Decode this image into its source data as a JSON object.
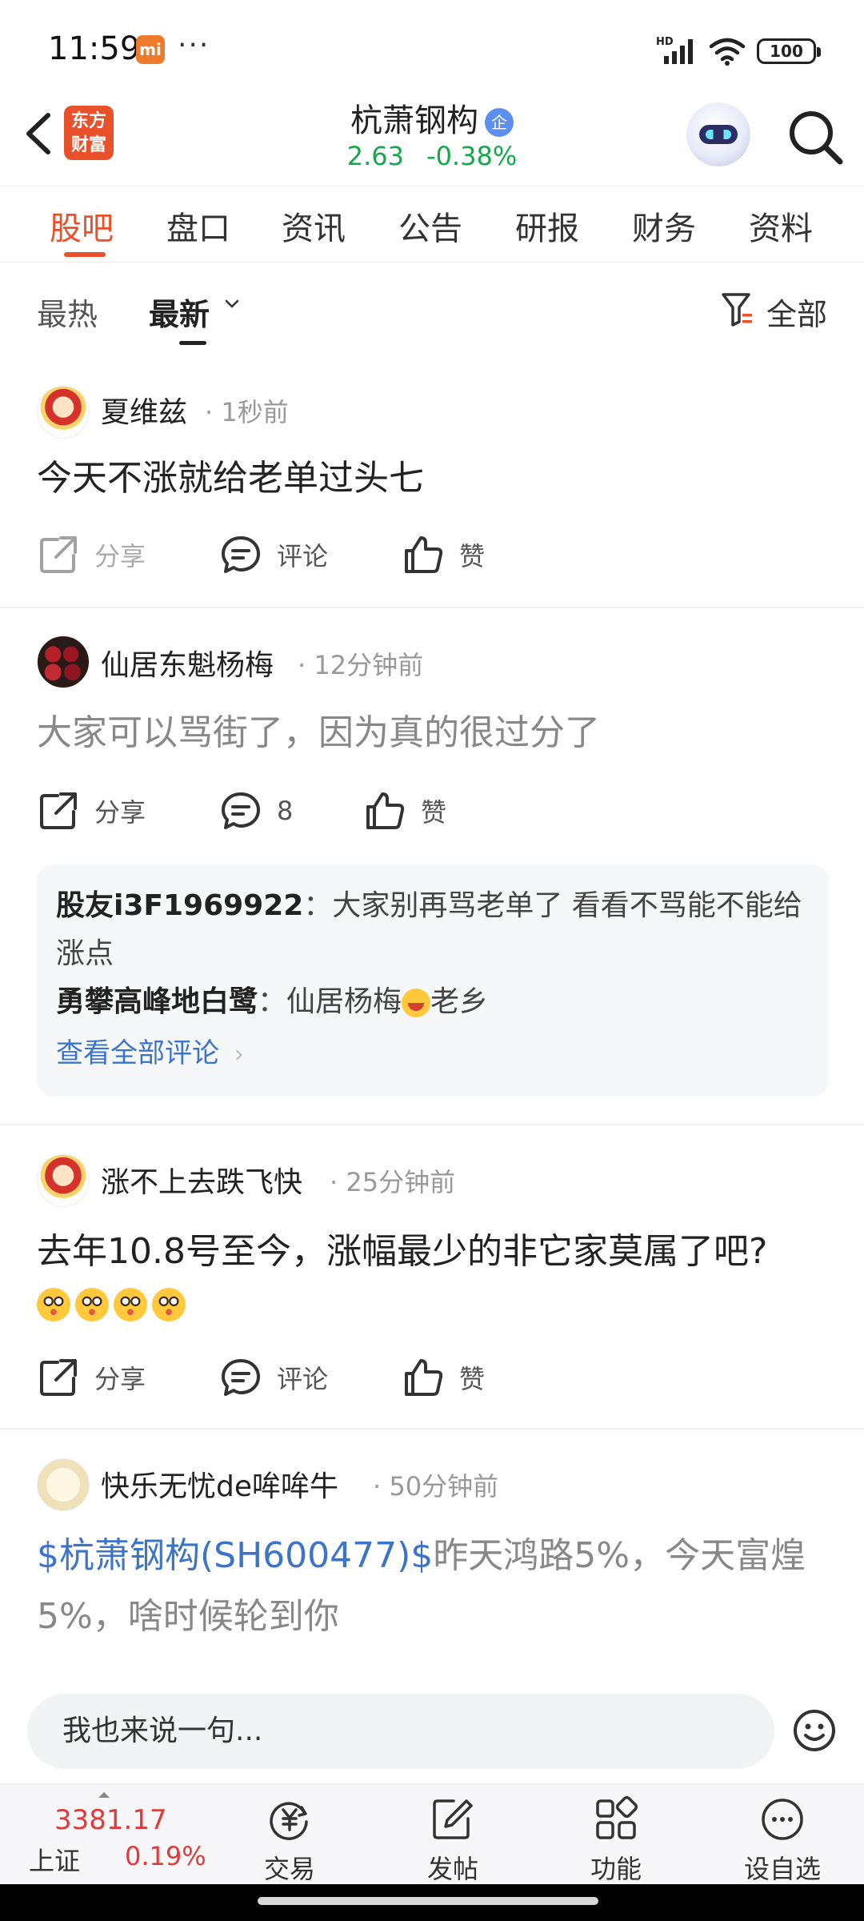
{
  "status_bar": {
    "time": "11:59",
    "mi_badge": "mi",
    "dots": "···",
    "network": "HD",
    "battery": "100"
  },
  "header": {
    "logo_text": "东方财富",
    "stock_name": "杭萧钢构",
    "enterprise_badge": "企",
    "price": "2.63",
    "change": "-0.38%",
    "price_color": "#15a84b"
  },
  "tabs": [
    "股吧",
    "盘口",
    "资讯",
    "公告",
    "研报",
    "财务",
    "资料"
  ],
  "accent_color": "#e9512b",
  "filter": {
    "hot": "最热",
    "newest": "最新",
    "all": "全部"
  },
  "posts": [
    {
      "author": "夏维兹",
      "time": "· 1秒前",
      "content": "今天不涨就给老单过头七",
      "share": "分享",
      "comment": "评论",
      "like": "赞"
    },
    {
      "author": "仙居东魁杨梅",
      "time": "· 12分钟前",
      "content": "大家可以骂街了，因为真的很过分了",
      "share": "分享",
      "comment": "8",
      "like": "赞",
      "comments": [
        {
          "name": "股友i3F1969922",
          "text": "：大家别再骂老单了  看看不骂能不能给涨点"
        },
        {
          "name": "勇攀高峰地白鹭",
          "text_before": "：仙居杨梅",
          "text_after": "老乡"
        }
      ],
      "view_all": "查看全部评论"
    },
    {
      "author": "涨不上去跌飞快",
      "time": "· 25分钟前",
      "content": "去年10.8号至今，涨幅最少的非它家莫属了吧?",
      "share": "分享",
      "comment": "评论",
      "like": "赞"
    },
    {
      "author": "快乐无忧de哞哞牛",
      "time": "· 50分钟前",
      "content_link": "$杭萧钢构(SH600477)$",
      "content_rest": "昨天鸿路5%，今天富煌5%，啥时候轮到你"
    }
  ],
  "input": {
    "placeholder": "我也来说一句..."
  },
  "bottom_nav": {
    "index_value": "3381.17",
    "index_label": "上证",
    "index_change": "0.19%",
    "items": [
      "交易",
      "发帖",
      "功能",
      "设自选"
    ]
  }
}
